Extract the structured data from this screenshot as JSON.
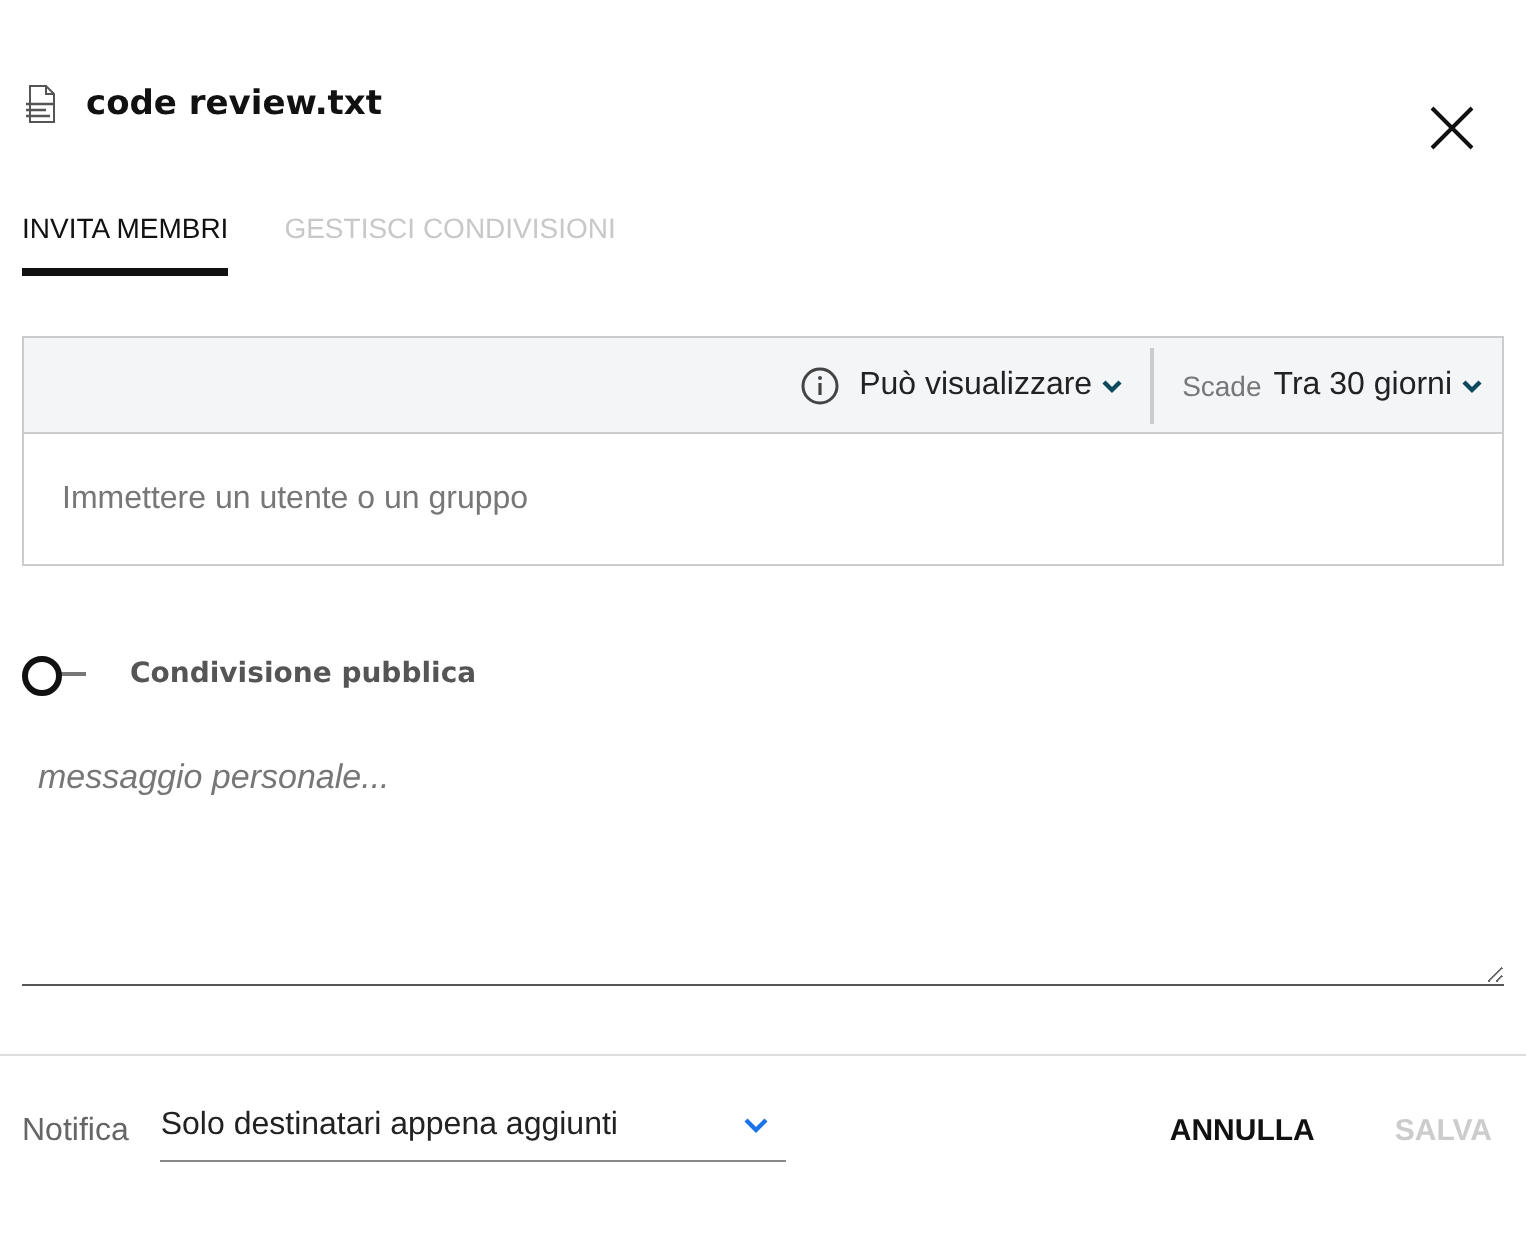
{
  "dialog": {
    "title": "code review.txt"
  },
  "tabs": [
    {
      "label": "INVITA MEMBRI",
      "selected": true
    },
    {
      "label": "GESTISCI CONDIVISIONI",
      "selected": false
    }
  ],
  "invite": {
    "permission": "Può visualizzare",
    "expiry_label": "Scade",
    "expiry": "Tra 30 giorni",
    "placeholder": "Immettere un utente o un gruppo"
  },
  "public_share": {
    "label": "Condivisione pubblica",
    "on": false
  },
  "message": {
    "placeholder": "messaggio personale..."
  },
  "footer": {
    "notify_label": "Notifica",
    "notify_value": "Solo destinatari appena aggiunti",
    "buttons": [
      {
        "label": "ANNULLA",
        "disabled": false
      },
      {
        "label": "SALVA",
        "disabled": true
      }
    ]
  }
}
